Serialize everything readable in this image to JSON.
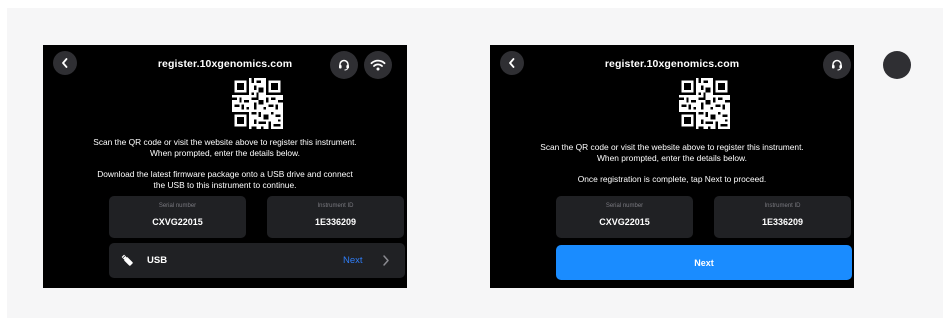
{
  "screens": [
    {
      "title": "register.10xgenomics.com",
      "instructions_line1": "Scan the QR code or visit the website above to register this instrument.",
      "instructions_line2": "When prompted, enter the details below.",
      "note_line1": "Download the latest firmware package onto a USB drive and connect",
      "note_line2": "the USB to this instrument to continue.",
      "serial_label": "Serial number",
      "serial_value": "CXVG22015",
      "instrument_label": "Instrument ID",
      "instrument_value": "1E336209",
      "usb_label": "USB",
      "usb_next_label": "Next",
      "icons": [
        "back-icon",
        "support-icon",
        "wifi-icon",
        "qr-code-icon",
        "usb-icon",
        "chevron-right-icon"
      ]
    },
    {
      "title": "register.10xgenomics.com",
      "instructions_line1": "Scan the QR code or visit the website above to register this instrument.",
      "instructions_line2": "When prompted, enter the details below.",
      "note_line1": "Once registration is complete, tap Next to proceed.",
      "serial_label": "Serial number",
      "serial_value": "CXVG22015",
      "instrument_label": "Instrument ID",
      "instrument_value": "1E336209",
      "next_button_label": "Next",
      "icons": [
        "back-icon",
        "support-icon",
        "qr-code-icon"
      ]
    }
  ],
  "colors": {
    "screen_background": "#000000",
    "panel_background": "#202124",
    "circle_button": "#2f2f33",
    "accent_blue": "#1a8cff",
    "link_blue": "#2f7df6",
    "muted_text": "#7a7a80"
  }
}
